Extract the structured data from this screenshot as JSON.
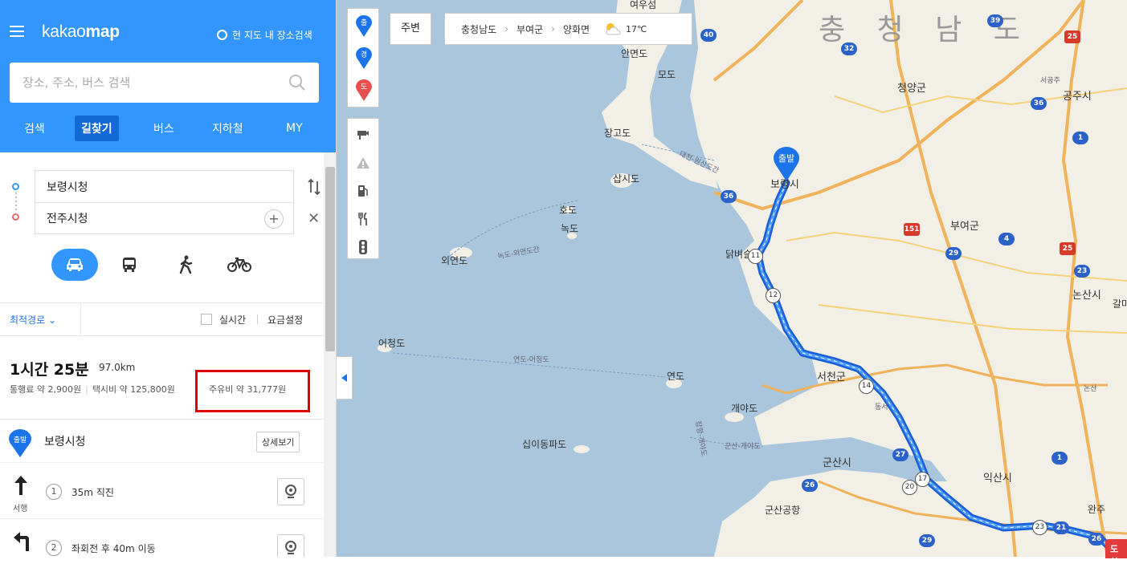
{
  "app": {
    "brand_light": "kakao",
    "brand_bold": "map",
    "map_search_label": "현 지도 내 장소검색"
  },
  "search": {
    "placeholder": "장소, 주소, 버스 검색"
  },
  "nav": {
    "tabs": [
      "검색",
      "길찾기",
      "버스",
      "지하철",
      "MY"
    ],
    "active": "길찾기"
  },
  "route": {
    "origin": "보령시청",
    "destination": "전주시청"
  },
  "modes": [
    "car-icon",
    "bus-icon",
    "walk-icon",
    "bike-icon"
  ],
  "options": {
    "sort": "최적경로",
    "realtime": "실시간",
    "fare_setting": "요금설정"
  },
  "summary": {
    "time": "1시간 25분",
    "distance": "97.0km",
    "toll": "통행료 약 2,900원",
    "taxi": "택시비 약 125,800원",
    "fuel": "주유비 약 31,777원"
  },
  "steps": {
    "start_badge": "출발",
    "start_name": "보령시청",
    "detail_button": "상세보기",
    "items": [
      {
        "num": "1",
        "text": "35m 직진",
        "direction": "서행"
      },
      {
        "num": "2",
        "text": "좌회전 후 40m 이동"
      }
    ]
  },
  "map_tools": {
    "start": "출",
    "via": "경",
    "dest": "도"
  },
  "map_top": {
    "around": "주변",
    "region1": "충청남도",
    "region2": "부여군",
    "region3": "양화면",
    "temp": "17℃"
  },
  "map_labels": {
    "province": "충 청 남 도",
    "places": [
      "여우섬",
      "안면도",
      "모도",
      "장고도",
      "삽시도",
      "호도",
      "녹도",
      "외연도",
      "어청도",
      "연도",
      "개야도",
      "십이동파도",
      "닭벼슬",
      "서천군",
      "군산시",
      "군산공항",
      "익산시",
      "청양군",
      "공주시",
      "부여군",
      "논산시",
      "보령시",
      "서공주",
      "동서",
      "논산",
      "완주",
      "갈마"
    ],
    "sea_routes": [
      "대천-원산도간",
      "녹도-외연도간",
      "연도-어청도",
      "군산-개야도",
      "장항-개야도"
    ],
    "start_pin": "출발",
    "end_pin": "도착"
  },
  "road_shields": [
    "40",
    "36",
    "32",
    "39",
    "25",
    "151",
    "4",
    "29",
    "25",
    "23",
    "11",
    "12",
    "14",
    "27",
    "17",
    "20",
    "26",
    "29",
    "23",
    "21",
    "26",
    "1",
    "1",
    "36"
  ],
  "colors": {
    "header": "#3396ff",
    "active_tab": "#1369d6",
    "route_line": "#1a73e8",
    "highlight": "#e00000",
    "sea": "#a9c6dd",
    "land": "#f2efe6"
  }
}
